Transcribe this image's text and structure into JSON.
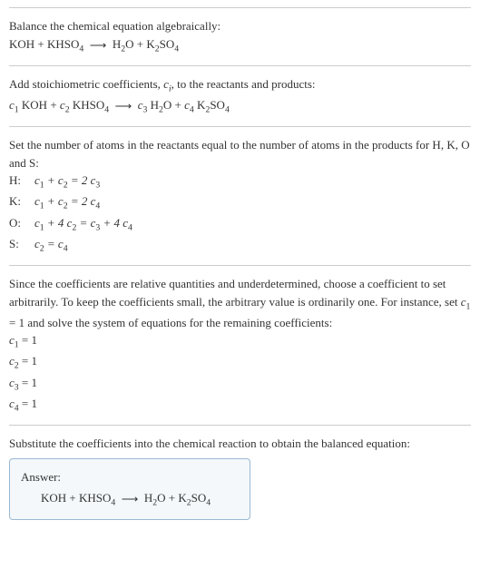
{
  "s1": {
    "line1": "Balance the chemical equation algebraically:",
    "eq_pre": "KOH + KHSO",
    "eq_post1": "H",
    "eq_post2": "O + K",
    "eq_post3": "SO"
  },
  "s2": {
    "line1_a": "Add stoichiometric coefficients, ",
    "line1_b": "c",
    "line1_c": ", to the reactants and products:",
    "c1": "c",
    "v1": "1",
    "c2": "c",
    "v2": "2",
    "c3": "c",
    "v3": "3",
    "c4": "c",
    "v4": "4",
    "khso": " KHSO",
    "koh": " KOH + ",
    "h2o": " H",
    "o_plus": "O + ",
    "k2so4_k": " K",
    "k2so4_so": "SO"
  },
  "s3": {
    "line1": "Set the number of atoms in the reactants equal to the number of atoms in the products for H, K, O and S:",
    "H": "H:",
    "H_eq_a": "c",
    "H_eq_b": " + c",
    "H_eq_c": " = 2 c",
    "K": "K:",
    "K_eq_a": "c",
    "K_eq_b": " + c",
    "K_eq_c": " = 2 c",
    "O": "O:",
    "O_eq_a": "c",
    "O_eq_b": " + 4 c",
    "O_eq_c": " = c",
    "O_eq_d": " + 4 c",
    "S": "S:",
    "S_eq_a": "c",
    "S_eq_b": " = c"
  },
  "s4": {
    "line1_a": "Since the coefficients are relative quantities and underdetermined, choose a coefficient to set arbitrarily. To keep the coefficients small, the arbitrary value is ordinarily one. For instance, set ",
    "line1_b": "c",
    "line1_c": " = 1 and solve the system of equations for the remaining coefficients:",
    "r1a": "c",
    "r1b": " = 1",
    "r2a": "c",
    "r2b": " = 1",
    "r3a": "c",
    "r3b": " = 1",
    "r4a": "c",
    "r4b": " = 1"
  },
  "s5": {
    "line1": "Substitute the coefficients into the chemical reaction to obtain the balanced equation:",
    "answer_label": "Answer:",
    "eq_pre": "KOH + KHSO",
    "eq_h2o": "H",
    "eq_o_plus": "O + K",
    "eq_so": "SO"
  },
  "sub": {
    "one": "1",
    "two": "2",
    "three": "3",
    "four": "4",
    "i": "i"
  },
  "arrow": "⟶"
}
